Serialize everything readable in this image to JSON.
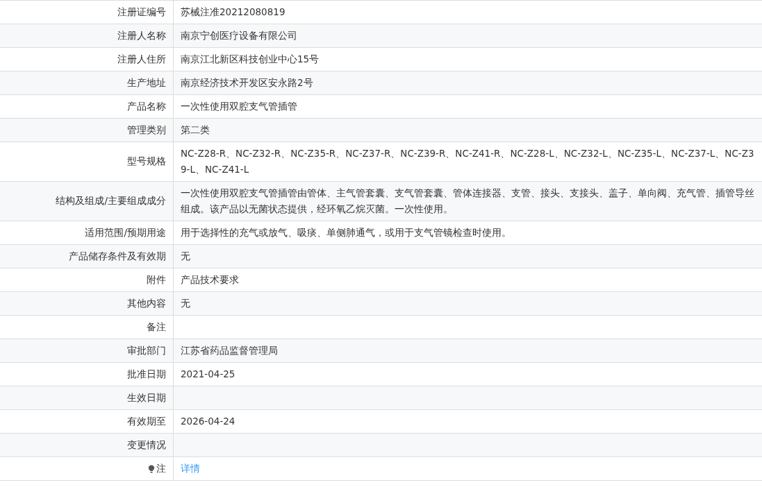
{
  "rows": [
    {
      "label": "注册证编号",
      "value": "苏械注准20212080819"
    },
    {
      "label": "注册人名称",
      "value": "南京宁创医疗设备有限公司"
    },
    {
      "label": "注册人住所",
      "value": "南京江北新区科技创业中心15号"
    },
    {
      "label": "生产地址",
      "value": "南京经济技术开发区安永路2号"
    },
    {
      "label": "产品名称",
      "value": "一次性使用双腔支气管插管"
    },
    {
      "label": "管理类别",
      "value": "第二类"
    },
    {
      "label": "型号规格",
      "value": "NC-Z28-R、NC-Z32-R、NC-Z35-R、NC-Z37-R、NC-Z39-R、NC-Z41-R、NC-Z28-L、NC-Z32-L、NC-Z35-L、NC-Z37-L、NC-Z39-L、NC-Z41-L"
    },
    {
      "label": "结构及组成/主要组成成分",
      "value": "一次性使用双腔支气管插管由管体、主气管套囊、支气管套囊、管体连接器、支管、接头、支接头、盖子、单向阀、充气管、插管导丝组成。该产品以无菌状态提供，经环氧乙烷灭菌。一次性使用。"
    },
    {
      "label": "适用范围/预期用途",
      "value": "用于选择性的充气或放气、吸痰、单侧肺通气，或用于支气管镜检查时使用。"
    },
    {
      "label": "产品储存条件及有效期",
      "value": "无"
    },
    {
      "label": "附件",
      "value": "产品技术要求"
    },
    {
      "label": "其他内容",
      "value": "无"
    },
    {
      "label": "备注"
    },
    {
      "label": "审批部门",
      "value": "江苏省药品监督管理局"
    },
    {
      "label": "批准日期",
      "value": "2021-04-25"
    },
    {
      "label": "生效日期"
    },
    {
      "label": "有效期至",
      "value": "2026-04-24"
    },
    {
      "label": "变更情况"
    },
    {
      "label": "注",
      "kind": "link",
      "value": "详情"
    }
  ]
}
